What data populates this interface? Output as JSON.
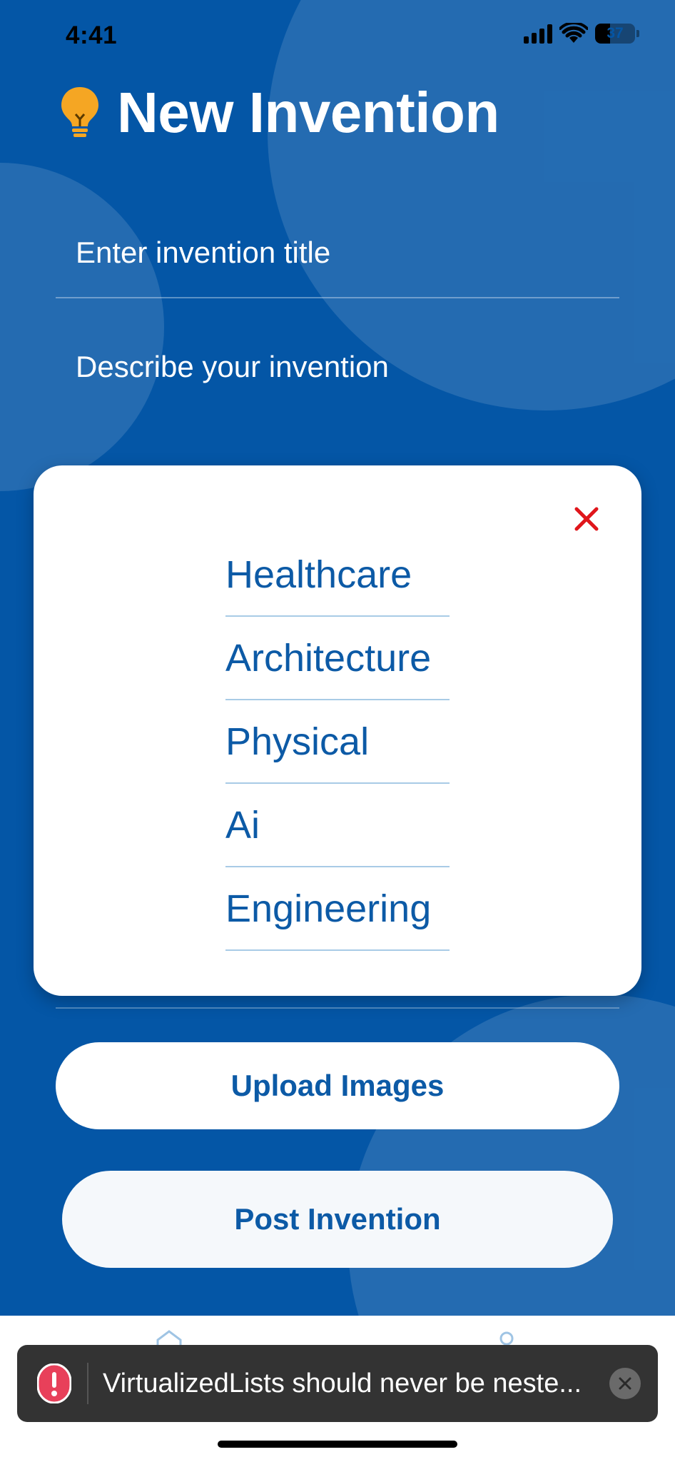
{
  "status_bar": {
    "time": "4:41",
    "battery_level": "37",
    "icons": [
      "signal-icon",
      "wifi-icon",
      "battery-icon"
    ]
  },
  "header": {
    "title": "New Invention",
    "icon": "lightbulb-icon"
  },
  "form": {
    "title_placeholder": "Enter invention title",
    "description_placeholder": "Describe your invention"
  },
  "category_modal": {
    "close_icon": "close-icon",
    "categories": [
      "Healthcare",
      "Architecture",
      "Physical",
      "Ai",
      "Engineering"
    ]
  },
  "buttons": {
    "upload_label": "Upload Images",
    "post_label": "Post Invention"
  },
  "tab_bar": {
    "icons": [
      "home-icon",
      "profile-icon"
    ]
  },
  "toast": {
    "message": "VirtualizedLists should never be neste...",
    "icons": [
      "error-icon",
      "dismiss-icon"
    ]
  },
  "colors": {
    "background": "#0456a6",
    "accent": "#0c5aa6",
    "close": "#e0161b",
    "bulb": "#f5a623",
    "toast_bg": "#333333",
    "error": "#e8405a"
  }
}
